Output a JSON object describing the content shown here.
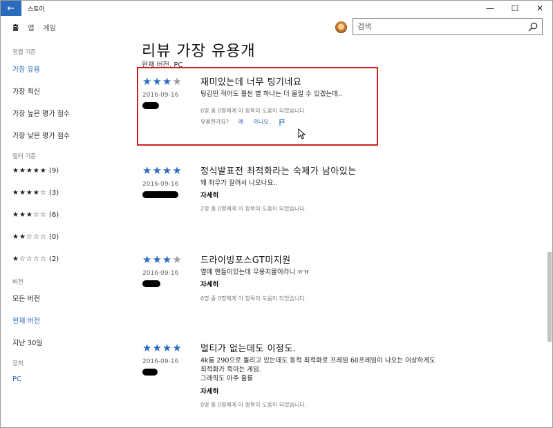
{
  "window": {
    "title": "스토어",
    "back_icon": "back-arrow-icon",
    "controls": [
      "minimize-icon",
      "maximize-icon",
      "close-icon"
    ]
  },
  "topnav": {
    "items": [
      "홈",
      "앱",
      "게임"
    ],
    "active_index": 0
  },
  "search": {
    "placeholder": "검색",
    "value": ""
  },
  "sidebar": {
    "sort_header": "정렬 기준",
    "sort_items": [
      "가장 유용",
      "가장 최신",
      "가장 높은 평가 점수",
      "가장 낮은 평가 점수"
    ],
    "sort_active": 0,
    "filter_header": "필터 기준",
    "filter_items": [
      {
        "stars": "★★★★★",
        "count": "(9)"
      },
      {
        "stars": "★★★★☆",
        "count": "(3)"
      },
      {
        "stars": "★★★☆☆",
        "count": "(6)"
      },
      {
        "stars": "★★☆☆☆",
        "count": "(0)"
      },
      {
        "stars": "★☆☆☆☆",
        "count": "(2)"
      }
    ],
    "version_header": "버전",
    "version_items": [
      "모든 버전",
      "현재 버전",
      "지난 30일"
    ],
    "version_active": 1,
    "device_header": "장치",
    "device_items": [
      "PC"
    ]
  },
  "main": {
    "title": "리뷰 가장 유용개",
    "subtitle": "현재 버전, PC"
  },
  "reviews": [
    {
      "rating": 3,
      "date": "2016-09-16",
      "title": "재미있는데 너무 팅기네요",
      "body": "팅김민 적어도 훨씬 별 하나는 더 올릴 수 있겠는데..",
      "more": "",
      "helpful": "0명 중 0명에게 이 항목이 도움이 되었습니다.",
      "feedback": {
        "question": "유용한가요?",
        "yes": "예",
        "no": "아니요",
        "flag_icon": "flag-icon"
      }
    },
    {
      "rating": 4,
      "date": "2016-09-16",
      "title": "정식발표전 최적화라는 숙제가 남아있는",
      "body": "왜 좌우가 잘려서 나오나요..",
      "more": "자세히",
      "helpful": "2명 중 0명에게 이 항목이 도움이 되었습니다."
    },
    {
      "rating": 3,
      "date": "2016-09-16",
      "title": "드라이빙포스GT미지원",
      "body": "옆에 핸들이있는데 무용지물이라니 ㅠㅠ",
      "more": "자세히",
      "helpful": "0명 중 0명에게 이 항목이 도움이 되었습니다."
    },
    {
      "rating": 4,
      "date": "2016-09-16",
      "title": "멀티가 없는데도 이정도.",
      "body": "4k를 290으로 돌리고 있는데도 동적 최적화로 프레임 60프레임이 나오는 이상하게도\n최적화가 죽이는 게임.\n그래픽도 아주 훌륭",
      "more": "자세히",
      "helpful": "0명 중 0명에게 이 항목이 도움이 되었습니다."
    }
  ],
  "colors": {
    "accent": "#2b6bbd",
    "highlight": "#d0201c",
    "star_off": "#9a9a9a"
  }
}
